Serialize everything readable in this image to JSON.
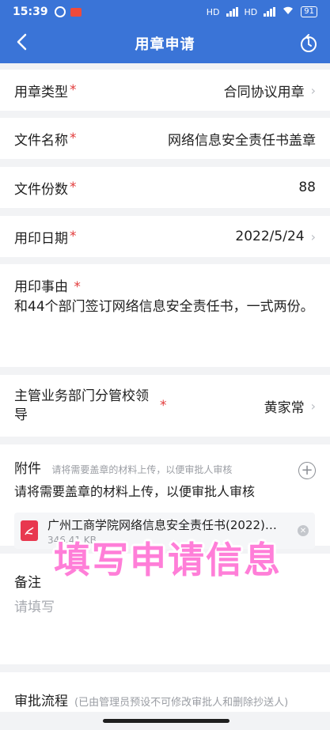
{
  "status_bar": {
    "time": "15:39",
    "battery": "91",
    "network_a": "HD",
    "network_b": "HD"
  },
  "header": {
    "title": "用章申请",
    "back_icon": "chevron-left-icon",
    "history_icon": "history-icon"
  },
  "form": {
    "seal_type": {
      "label": "用章类型",
      "required": "*",
      "value": "合同协议用章"
    },
    "file_name": {
      "label": "文件名称",
      "required": "*",
      "value": "网络信息安全责任书盖章"
    },
    "file_copies": {
      "label": "文件份数",
      "required": "*",
      "value": "88"
    },
    "seal_date": {
      "label": "用印日期",
      "required": "*",
      "value": "2022/5/24"
    },
    "seal_reason": {
      "label": "用印事由",
      "required": "*",
      "value": "和44个部门签订网络信息安全责任书，一式两份。"
    },
    "supervisor": {
      "label": "主管业务部门分管校领导",
      "required": "*",
      "value": "黄家常"
    },
    "attachment": {
      "label": "附件",
      "hint": "请将需要盖章的材料上传，以便审批人审核",
      "description": "请将需要盖章的材料上传，以便审批人审核",
      "file": {
        "name": "广州工商学院网络信息安全责任书(2022)…",
        "size": "346.41 KB"
      }
    },
    "remarks": {
      "label": "备注",
      "placeholder": "请填写"
    },
    "approval": {
      "label": "审批流程",
      "hint": "(已由管理员预设不可修改审批人和删除抄送人)"
    }
  },
  "overlay": {
    "caption": "填写申请信息"
  },
  "colors": {
    "header_bg": "#3a74d7",
    "required": "#e23b3b",
    "overlay_text": "#ff7ed8",
    "pdf": "#e8384f"
  }
}
